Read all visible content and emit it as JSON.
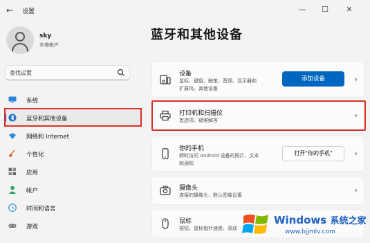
{
  "window": {
    "title": "设置",
    "back": "←",
    "minimize": "—",
    "maximize": "☐",
    "close": "✕"
  },
  "account": {
    "name": "sky",
    "type": "本地帐户"
  },
  "search": {
    "placeholder": "查找设置"
  },
  "sidebar": {
    "items": [
      {
        "label": "系统",
        "icon": "monitor-icon"
      },
      {
        "label": "蓝牙和其他设备",
        "icon": "bluetooth-icon",
        "selected": true
      },
      {
        "label": "网络和 Internet",
        "icon": "wifi-icon"
      },
      {
        "label": "个性化",
        "icon": "brush-icon"
      },
      {
        "label": "应用",
        "icon": "apps-icon"
      },
      {
        "label": "帐户",
        "icon": "person-icon"
      },
      {
        "label": "时间和语言",
        "icon": "globe-clock-icon"
      },
      {
        "label": "游戏",
        "icon": "game-icon"
      }
    ]
  },
  "main": {
    "title": "蓝牙和其他设备",
    "cards": [
      {
        "title": "设备",
        "subtitle_line1": "鼠标、键盘、触笔、音频、显示器和",
        "subtitle_line2": "扩展坞、其他设备",
        "button": "添加设备",
        "icon": "devices-icon"
      },
      {
        "title": "打印机和扫描仪",
        "subtitle_line1": "首选项、疑难解答",
        "icon": "printer-icon"
      },
      {
        "title": "你的手机",
        "subtitle_line1": "即时访问 Android 设备的照片、文本",
        "subtitle_line2": "和通知",
        "button": "打开\"你的手机\"",
        "icon": "phone-icon"
      },
      {
        "title": "摄像头",
        "subtitle_line1": "连接的摄像头、默认图像设置",
        "icon": "camera-icon"
      },
      {
        "title": "鼠标",
        "subtitle_line1": "按钮、鼠标指针速度、滚动",
        "icon": "mouse-icon"
      }
    ],
    "chevron": "›"
  },
  "watermark": {
    "brand": "Windows",
    "brand_cn": "系统之家",
    "url": "www.bjjmlv.com"
  },
  "colors": {
    "accent": "#0067c0",
    "highlight": "#d9312a"
  }
}
